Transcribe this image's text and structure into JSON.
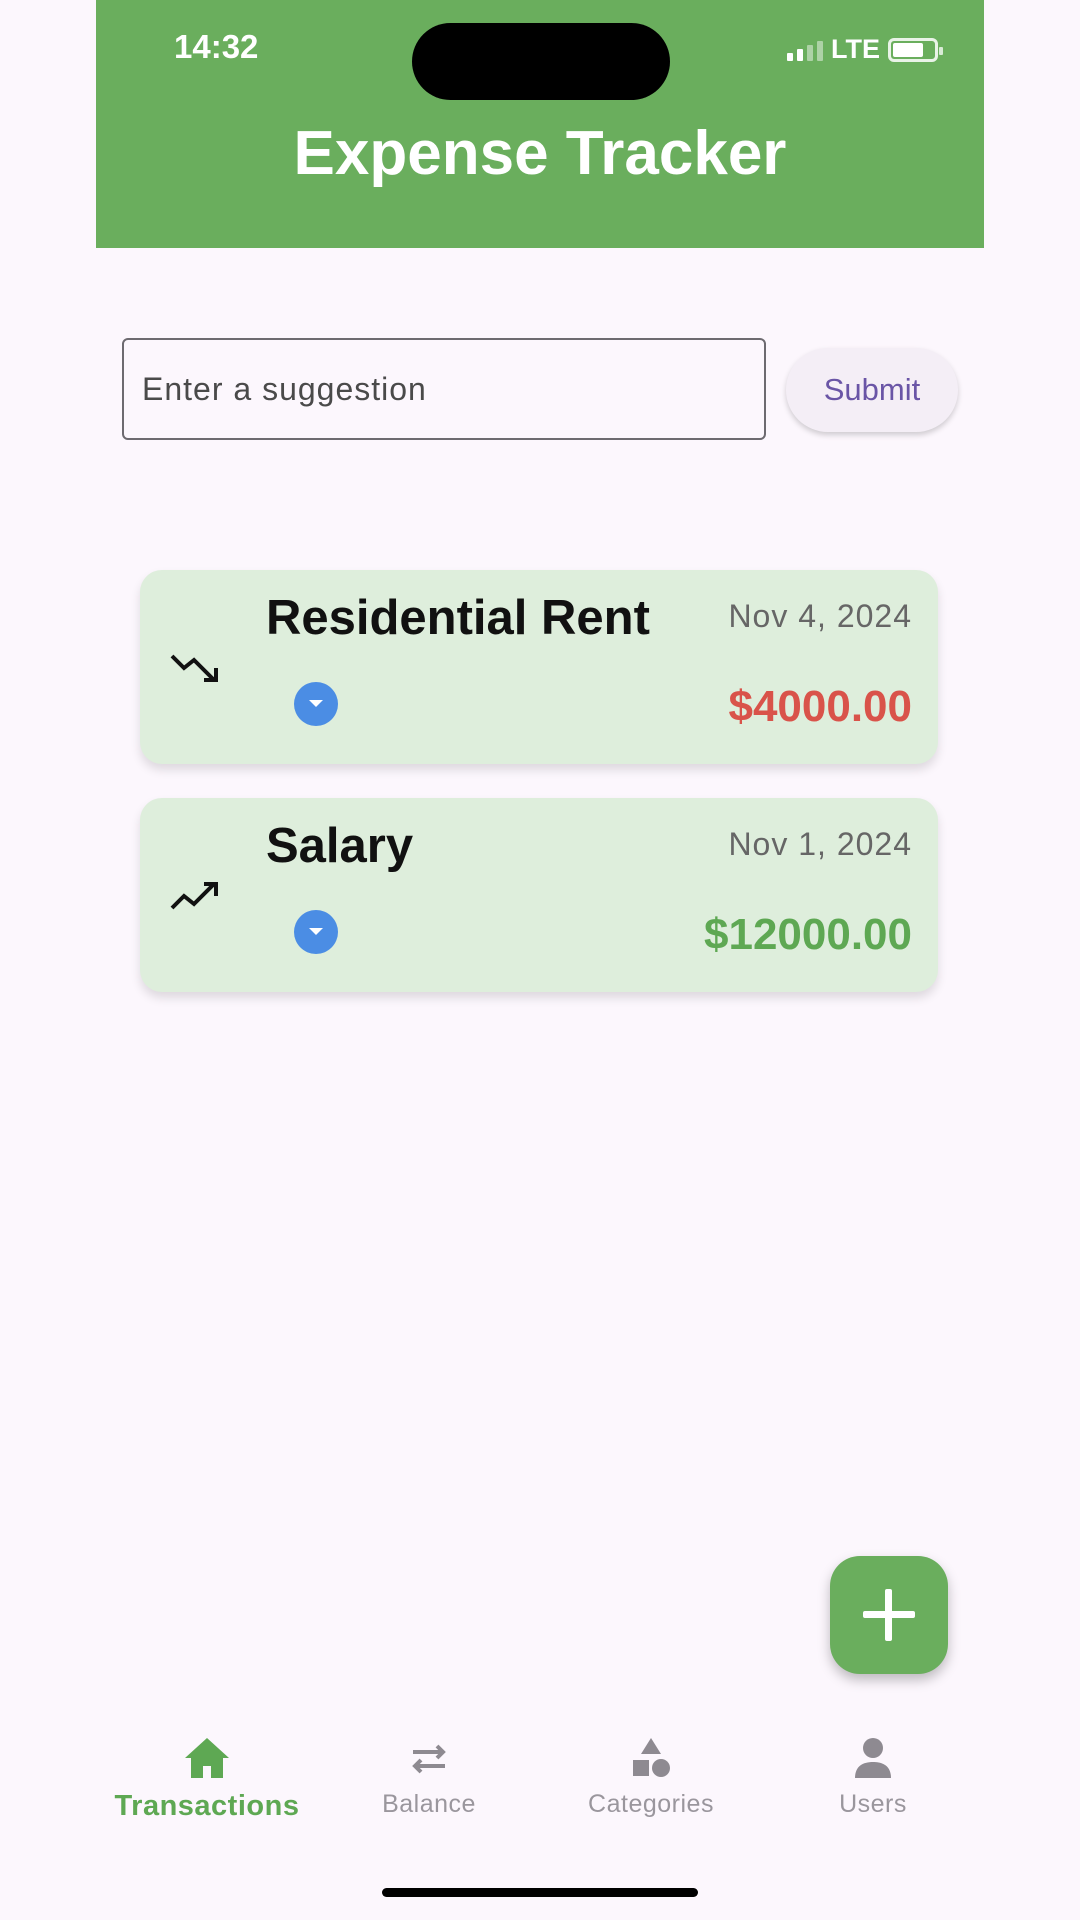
{
  "status_bar": {
    "time": "14:32",
    "network": "LTE"
  },
  "header": {
    "title": "Expense Tracker"
  },
  "suggestion": {
    "placeholder": "Enter a suggestion",
    "value": "",
    "submit_label": "Submit"
  },
  "transactions": [
    {
      "title": "Residential Rent",
      "date": "Nov 4, 2024",
      "amount": "$4000.00",
      "type": "expense",
      "amount_color": "#d9534a",
      "icon": "trending-down-icon"
    },
    {
      "title": "Salary",
      "date": "Nov 1, 2024",
      "amount": "$12000.00",
      "type": "income",
      "amount_color": "#5ea853",
      "icon": "trending-up-icon"
    }
  ],
  "fab": {
    "icon": "plus-icon"
  },
  "bottom_nav": {
    "items": [
      {
        "label": "Transactions",
        "icon": "home-icon",
        "active": true
      },
      {
        "label": "Balance",
        "icon": "swap-icon",
        "active": false
      },
      {
        "label": "Categories",
        "icon": "shapes-icon",
        "active": false
      },
      {
        "label": "Users",
        "icon": "person-icon",
        "active": false
      }
    ]
  },
  "colors": {
    "accent": "#6aae5d",
    "card": "#deeedc",
    "expense": "#d9534a",
    "income": "#5ea853"
  }
}
